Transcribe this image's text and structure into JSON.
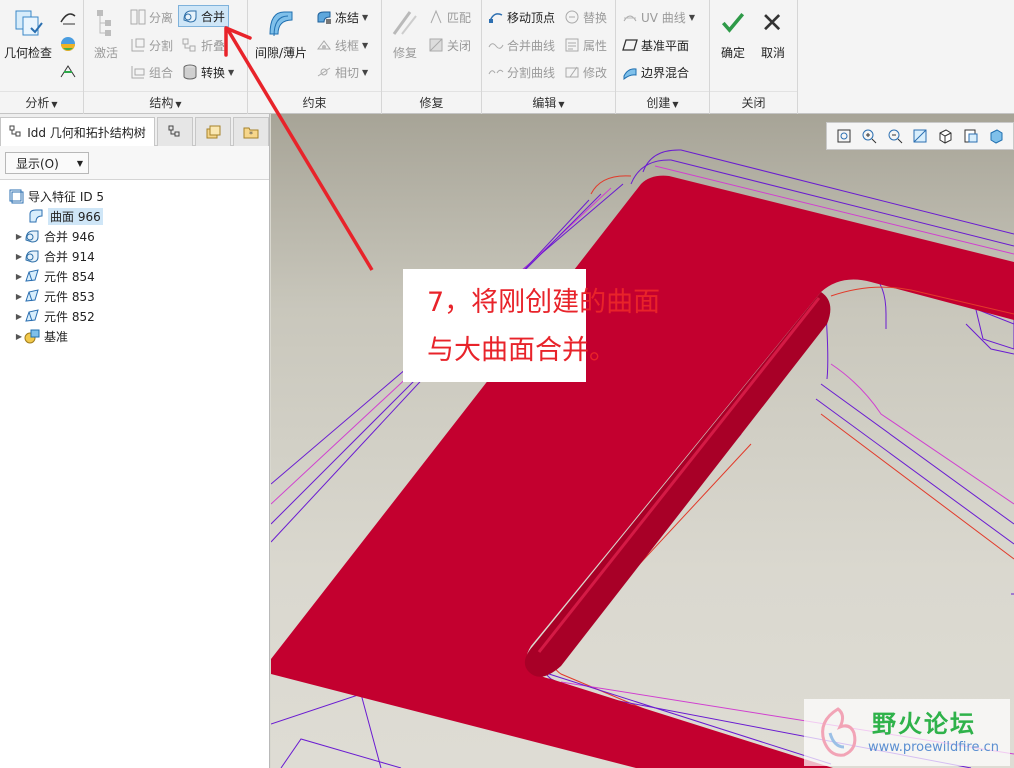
{
  "ribbon": {
    "analysis": {
      "geometry_check": "几何检查",
      "group": "分析"
    },
    "structure": {
      "activate": "激活",
      "separate": "分离",
      "merge": "合并",
      "split": "分割",
      "fold": "折叠",
      "combine": "组合",
      "convert": "转换",
      "group": "结构"
    },
    "constraint": {
      "gap_sheet": "间隙/薄片",
      "freeze": "冻结",
      "wireframe": "线框",
      "tangent": "相切",
      "group": "约束"
    },
    "repair": {
      "repair": "修复",
      "match": "匹配",
      "close": "关闭",
      "group": "修复"
    },
    "edit": {
      "move_vertex": "移动顶点",
      "replace": "替换",
      "merge_curves": "合并曲线",
      "property": "属性",
      "split_curves": "分割曲线",
      "modify": "修改",
      "group": "编辑"
    },
    "create": {
      "uv_curve": "UV 曲线",
      "datum_plane": "基准平面",
      "boundary_blend": "边界混合",
      "group": "创建"
    },
    "close": {
      "ok": "确定",
      "cancel": "取消",
      "group": "关闭"
    }
  },
  "panel": {
    "tab_title": "Idd 几何和拓扑结构树",
    "show_select": "显示(O)",
    "tree": [
      {
        "label": "导入特征 ID 5",
        "icon": "import-feature-icon"
      },
      {
        "label": "曲面 966",
        "icon": "surface-icon"
      },
      {
        "label": "合并 946",
        "icon": "merge-icon"
      },
      {
        "label": "合并 914",
        "icon": "merge-icon"
      },
      {
        "label": "元件 854",
        "icon": "component-icon"
      },
      {
        "label": "元件 853",
        "icon": "component-icon"
      },
      {
        "label": "元件 852",
        "icon": "component-icon"
      },
      {
        "label": "基准",
        "icon": "datum-icon"
      }
    ]
  },
  "callout": {
    "line1": "7，将刚创建的曲面",
    "line2": "与大曲面合并。"
  },
  "watermark": {
    "title": "野火论坛",
    "url": "www.proewildfire.cn"
  },
  "colors": {
    "surface_red": "#c3002f",
    "callout_red": "#e8232a",
    "edge_purple": "#6a1bd1",
    "edge_magenta": "#d040d0",
    "selection_blue": "#cfe6f7"
  }
}
